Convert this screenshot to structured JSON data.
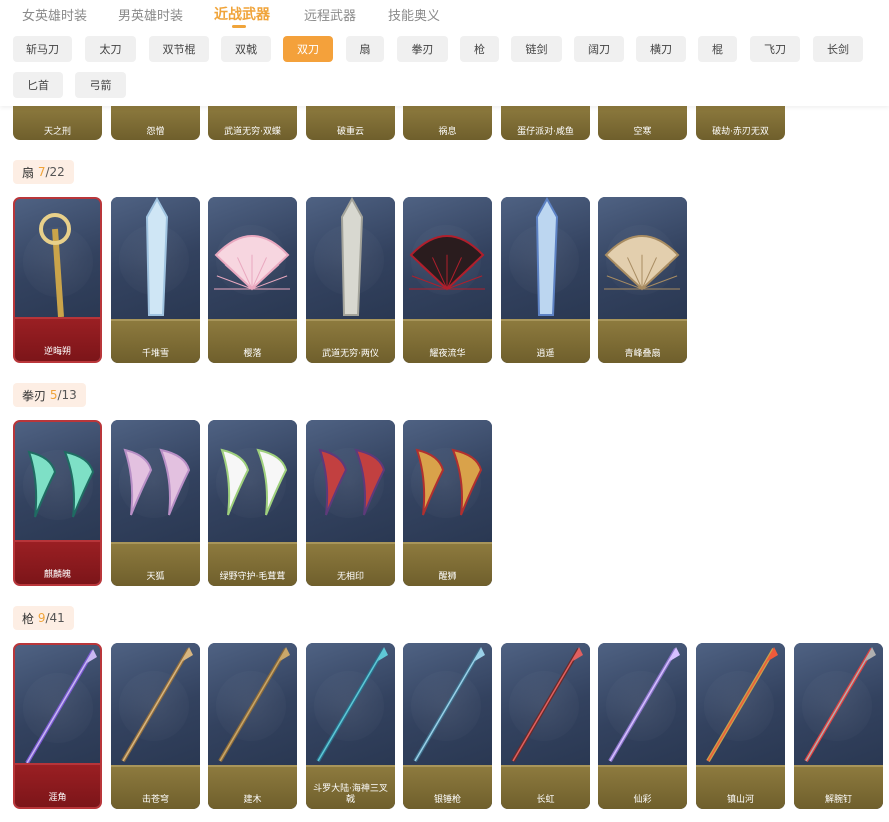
{
  "tabs": [
    "女英雄时装",
    "男英雄时装",
    "近战武器",
    "远程武器",
    "技能奥义"
  ],
  "active_tab": 2,
  "categories": [
    "斩马刀",
    "太刀",
    "双节棍",
    "双戟",
    "双刀",
    "扇",
    "拳刃",
    "枪",
    "链剑",
    "阔刀",
    "横刀",
    "棍",
    "飞刀",
    "长剑",
    "匕首",
    "弓箭"
  ],
  "active_category": 4,
  "prev_section": {
    "items": [
      "天之刑",
      "怨憎",
      "武道无穷·双蝶",
      "破重云",
      "祸息",
      "蛋仔派对·咸鱼",
      "空寒",
      "破劫·赤刃无双"
    ]
  },
  "sections": [
    {
      "title": "扇",
      "owned": "7",
      "total": "22",
      "items": [
        {
          "name": "逆晦朔",
          "rare": true
        },
        {
          "name": "千堆雪",
          "rare": false
        },
        {
          "name": "樱落",
          "rare": false
        },
        {
          "name": "武道无穷·两仪",
          "rare": false
        },
        {
          "name": "耀夜流华",
          "rare": false
        },
        {
          "name": "逍遥",
          "rare": false
        },
        {
          "name": "青峰叠扇",
          "rare": false
        }
      ]
    },
    {
      "title": "拳刃",
      "owned": "5",
      "total": "13",
      "items": [
        {
          "name": "麒麟魄",
          "rare": true
        },
        {
          "name": "天狐",
          "rare": false
        },
        {
          "name": "绿野守护·毛茸茸",
          "rare": false
        },
        {
          "name": "无相印",
          "rare": false
        },
        {
          "name": "醒狮",
          "rare": false
        }
      ]
    },
    {
      "title": "枪",
      "owned": "9",
      "total": "41",
      "items": [
        {
          "name": "涯角",
          "rare": true
        },
        {
          "name": "击苍穹",
          "rare": false
        },
        {
          "name": "建木",
          "rare": false
        },
        {
          "name": "斗罗大陆·海神三叉戟",
          "rare": false
        },
        {
          "name": "银锤枪",
          "rare": false
        },
        {
          "name": "长虹",
          "rare": false
        },
        {
          "name": "仙彩",
          "rare": false
        },
        {
          "name": "镇山河",
          "rare": false
        },
        {
          "name": "解腕钉",
          "rare": false
        }
      ]
    }
  ]
}
